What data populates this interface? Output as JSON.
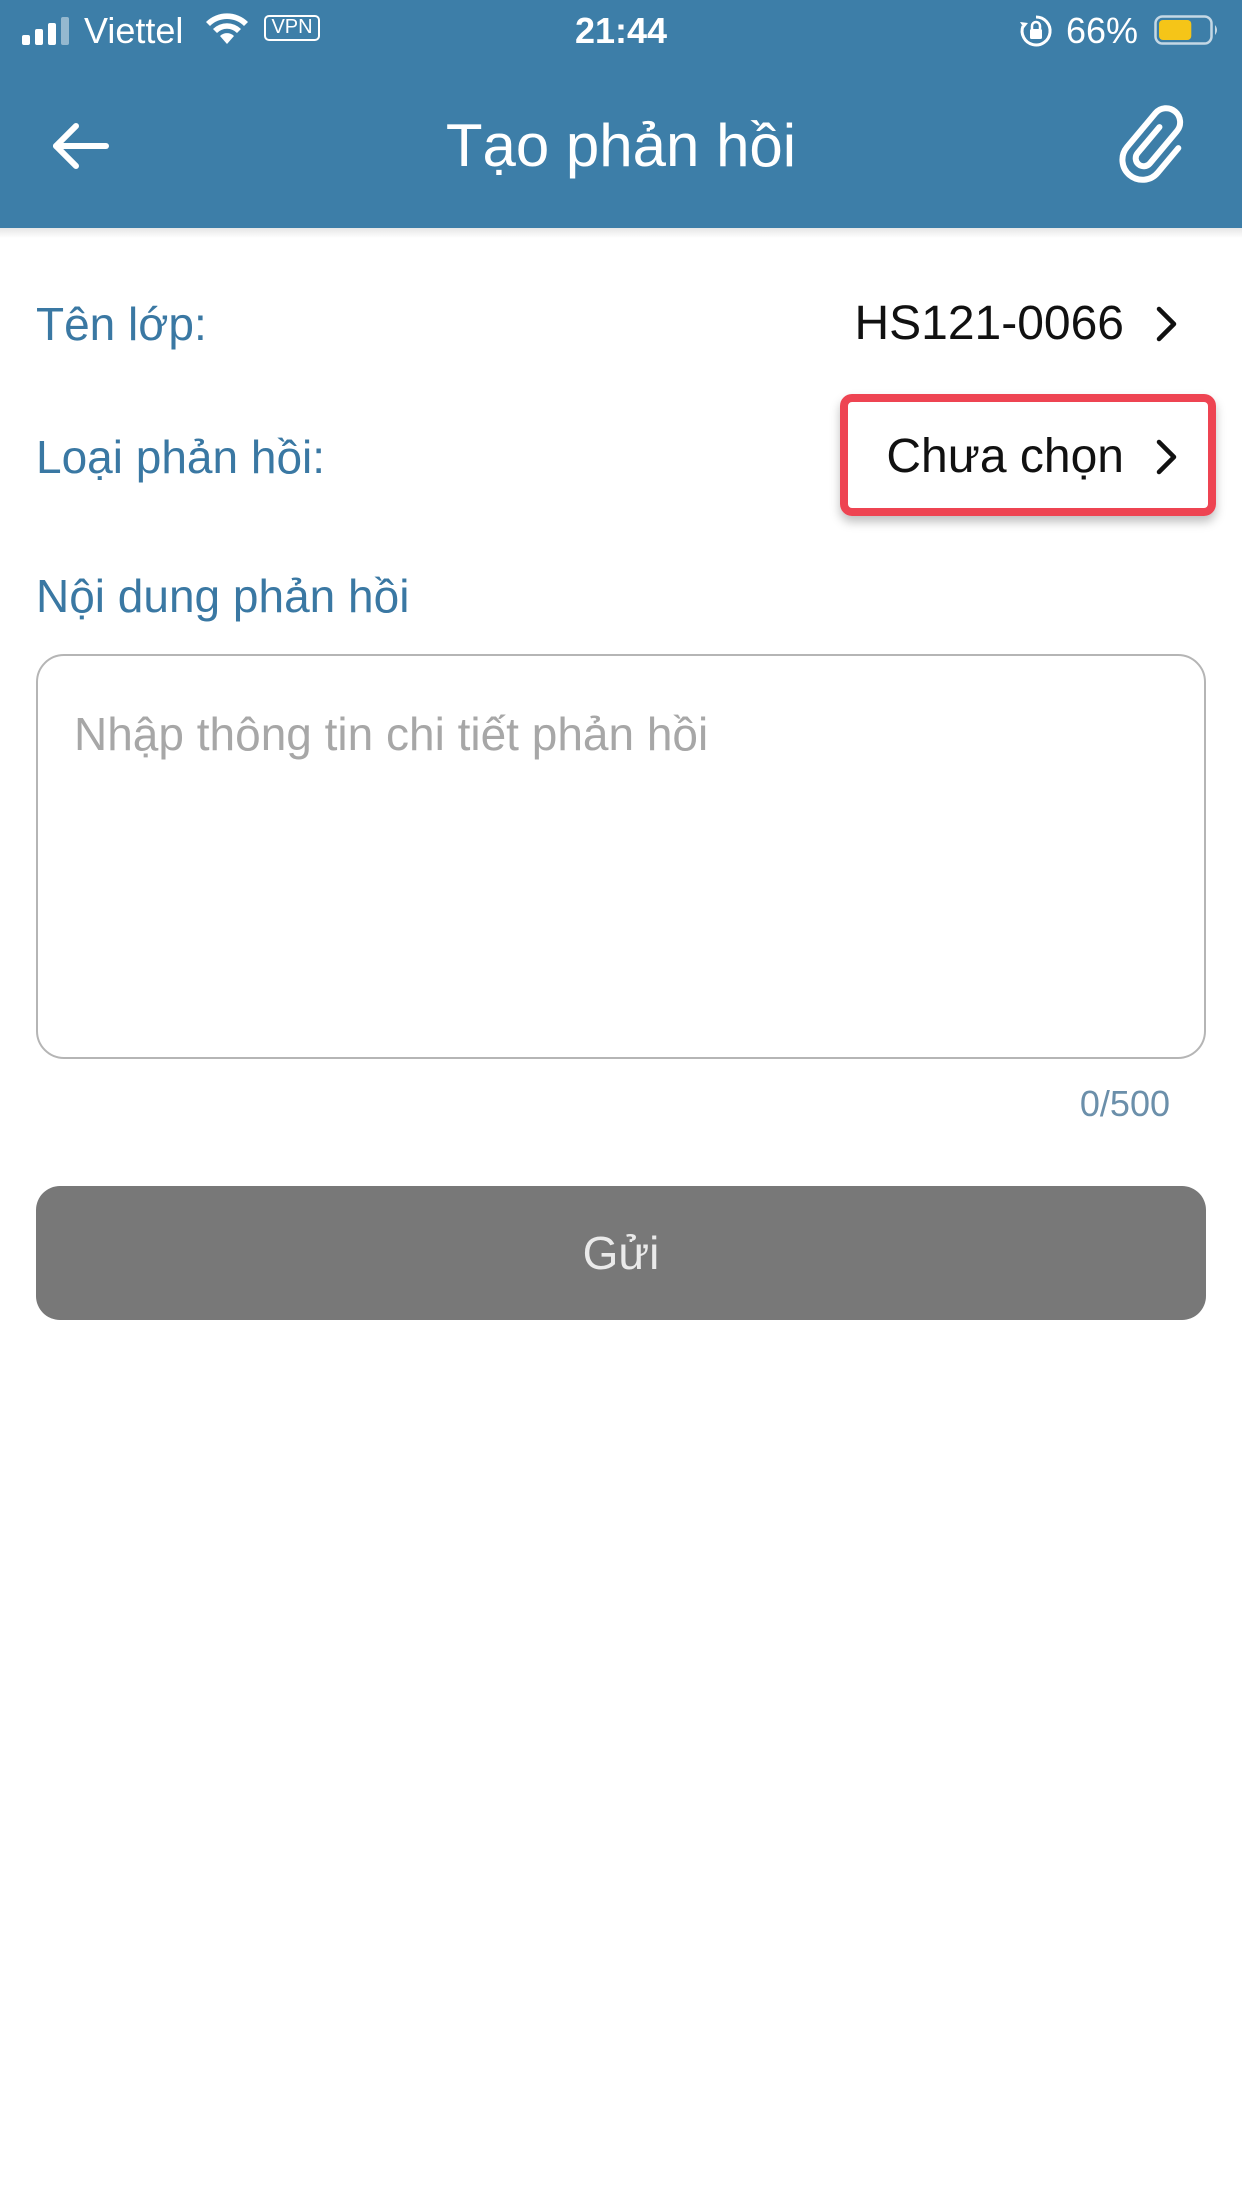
{
  "status_bar": {
    "carrier": "Viettel",
    "vpn": "VPN",
    "time": "21:44",
    "battery": "66%",
    "battery_level": 0.66,
    "battery_color": "#f5c518"
  },
  "header": {
    "title": "Tạo phản hồi",
    "background_color": "#3d7ea8",
    "back_icon": "arrow-left-icon",
    "attach_icon": "paperclip-icon"
  },
  "form": {
    "class_label": "Tên lớp:",
    "class_value": "HS121-0066",
    "type_label": "Loại phản hồi:",
    "type_value": "Chưa chọn",
    "content_label": "Nội dung phản hồi",
    "content_placeholder": "Nhập thông tin chi tiết phản hồi",
    "content_value": "",
    "counter": "0/500",
    "label_color": "#3a78a3"
  },
  "actions": {
    "send_label": "Gửi",
    "send_color": "#787878"
  },
  "annotation": {
    "highlight_color": "#ee4452",
    "highlighted_element": "feedback-type-selector"
  }
}
